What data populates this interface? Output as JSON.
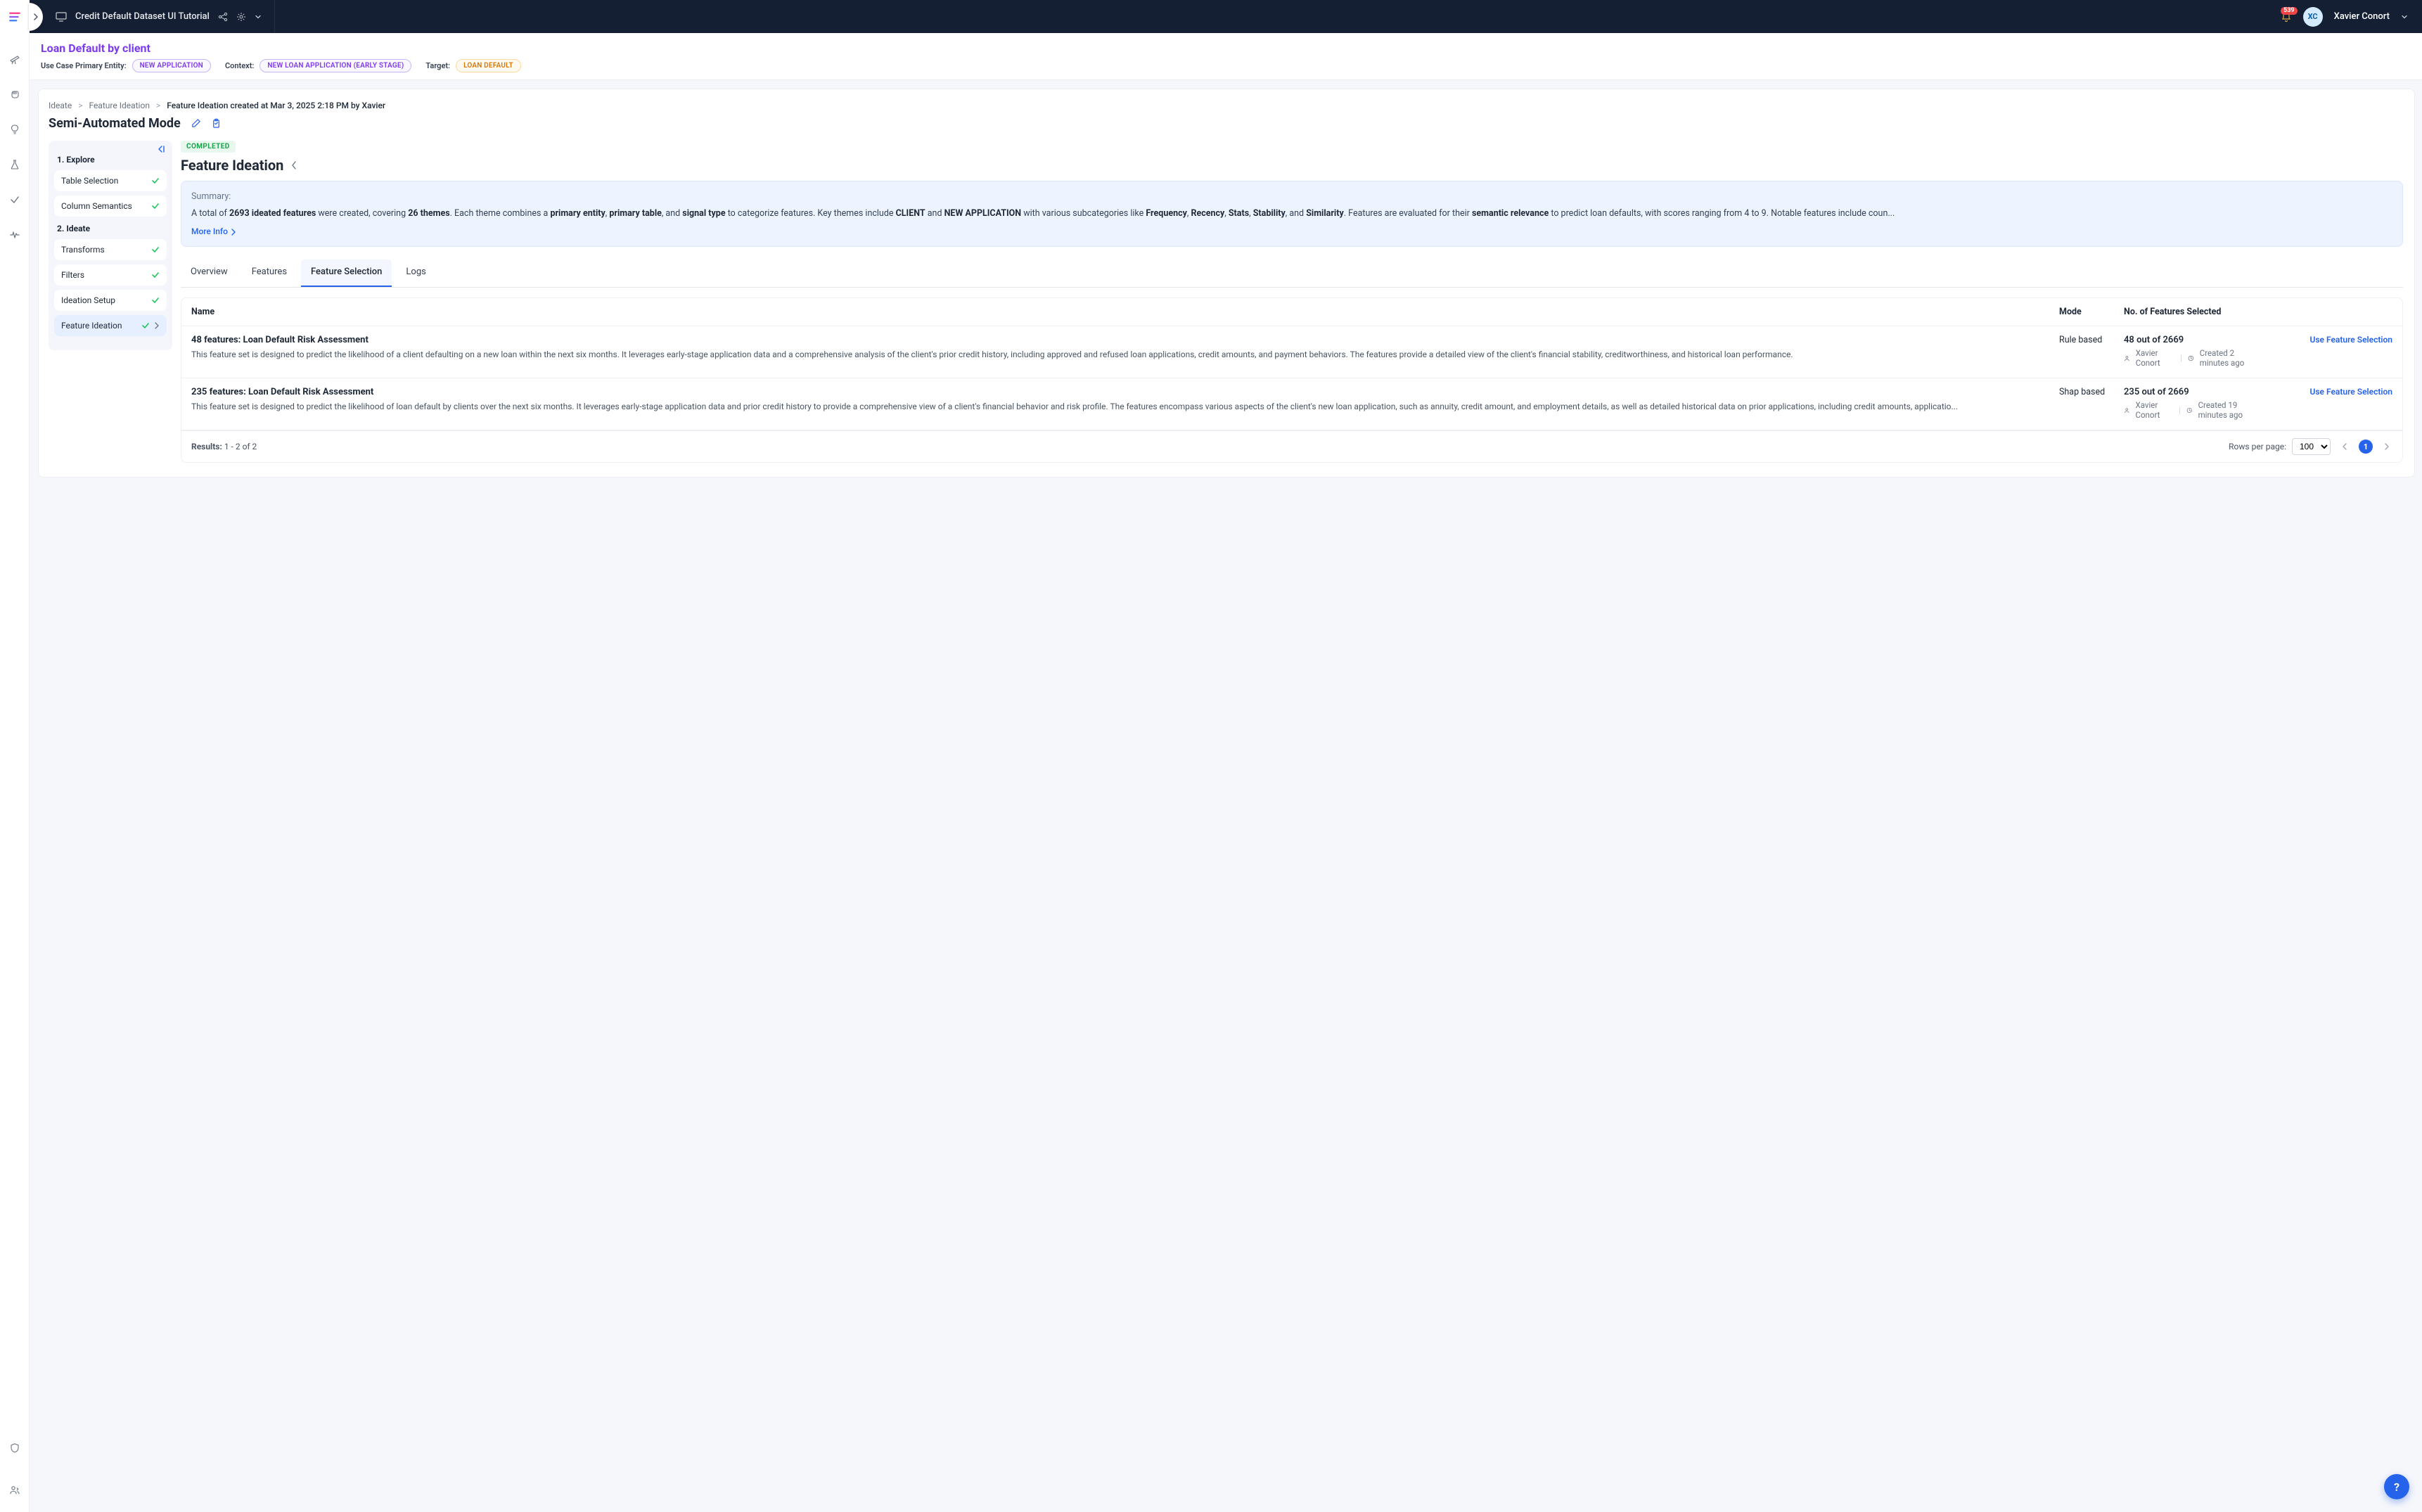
{
  "topbar": {
    "project_title": "Credit Default Dataset UI Tutorial",
    "notification_count": "539",
    "avatar_initials": "XC",
    "user_name": "Xavier Conort"
  },
  "context": {
    "title": "Loan Default by client",
    "primary_entity_label": "Use Case Primary Entity:",
    "primary_entity_value": "NEW APPLICATION",
    "context_label": "Context:",
    "context_value": "NEW LOAN APPLICATION (EARLY STAGE)",
    "target_label": "Target:",
    "target_value": "LOAN DEFAULT"
  },
  "breadcrumbs": {
    "a": "Ideate",
    "b": "Feature Ideation",
    "c": "Feature Ideation created at Mar 3, 2025 2:18 PM by Xavier"
  },
  "page": {
    "title": "Semi-Automated Mode"
  },
  "steps": {
    "group1": {
      "title": "1. Explore",
      "items": [
        "Table Selection",
        "Column Semantics"
      ]
    },
    "group2": {
      "title": "2. Ideate",
      "items": [
        "Transforms",
        "Filters",
        "Ideation Setup",
        "Feature Ideation"
      ]
    }
  },
  "detail": {
    "status": "COMPLETED",
    "heading": "Feature Ideation",
    "summary_label": "Summary:",
    "summary_pre": "A total of ",
    "summary_features": "2693 ideated features",
    "summary_mid1": " were created, covering ",
    "summary_themes": "26 themes",
    "summary_mid2": ". Each theme combines a ",
    "summary_pe": "primary entity",
    "summary_c1": ", ",
    "summary_pt": "primary table",
    "summary_c2": ", and ",
    "summary_st": "signal type",
    "summary_mid3": " to categorize features. Key themes include ",
    "summary_client": "CLIENT",
    "summary_and1": " and ",
    "summary_newapp": "NEW APPLICATION",
    "summary_mid4": " with various subcategories like ",
    "summary_freq": "Frequency",
    "summary_c3": ", ",
    "summary_rec": "Recency",
    "summary_c4": ", ",
    "summary_stats": "Stats",
    "summary_c5": ", ",
    "summary_stab": "Stability",
    "summary_and2": ", and ",
    "summary_sim": "Similarity",
    "summary_mid5": ". Features are evaluated for their ",
    "summary_sr": "semantic relevance",
    "summary_tail": " to predict loan defaults, with scores ranging from 4 to 9. Notable features include coun...",
    "more_info": "More Info"
  },
  "tabs": [
    "Overview",
    "Features",
    "Feature Selection",
    "Logs"
  ],
  "table": {
    "headers": {
      "name": "Name",
      "mode": "Mode",
      "count": "No. of Features Selected"
    },
    "rows": [
      {
        "title": "48 features: Loan Default Risk Assessment",
        "desc": "This feature set is designed to predict the likelihood of a client defaulting on a new loan within the next six months. It leverages early-stage application data and a comprehensive analysis of the client's prior credit history, including approved and refused loan applications, credit amounts, and payment behaviors. The features provide a detailed view of the client's financial stability, creditworthiness, and historical loan performance.",
        "mode": "Rule based",
        "count": "48 out of 2669",
        "author": "Xavier Conort",
        "created": "Created 2 minutes ago",
        "action": "Use Feature Selection"
      },
      {
        "title": "235 features: Loan Default Risk Assessment",
        "desc": "This feature set is designed to predict the likelihood of loan default by clients over the next six months. It leverages early-stage application data and prior credit history to provide a comprehensive view of a client's financial behavior and risk profile. The features encompass various aspects of the client's new loan application, such as annuity, credit amount, and employment details, as well as detailed historical data on prior applications, including credit amounts, applicatio...",
        "mode": "Shap based",
        "count": "235 out of 2669",
        "author": "Xavier Conort",
        "created": "Created 19 minutes ago",
        "action": "Use Feature Selection"
      }
    ],
    "footer": {
      "results_label": "Results: ",
      "results_value": "1 - 2 of 2",
      "rpp_label": "Rows per page:",
      "rpp_value": "100",
      "page": "1"
    }
  },
  "fab": {
    "label": "?"
  }
}
